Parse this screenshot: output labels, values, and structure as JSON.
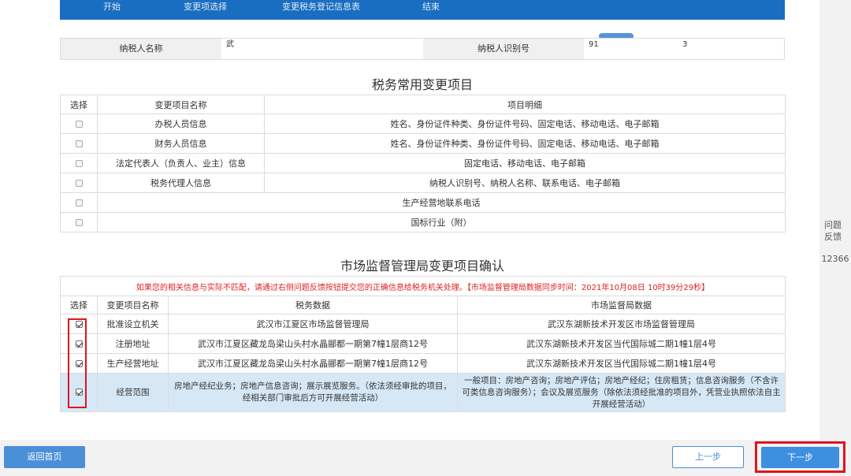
{
  "steps": [
    "开始",
    "变更项选择",
    "变更税务登记信息表",
    "结束"
  ],
  "taxpayer": {
    "name_label": "纳税人名称",
    "name_value": "武",
    "id_label": "纳税人识别号",
    "id_value_start": "91",
    "id_value_end": "3"
  },
  "tax_section": {
    "title": "税务常用变更项目",
    "headers": [
      "选择",
      "变更项目名称",
      "项目明细"
    ],
    "rows": [
      {
        "name": "办税人员信息",
        "detail": "姓名、身份证件种类、身份证件号码、固定电话、移动电话、电子邮箱",
        "checked": false
      },
      {
        "name": "财务人员信息",
        "detail": "姓名、身份证件种类、身份证件号码、固定电话、移动电话、电子邮箱",
        "checked": false
      },
      {
        "name": "法定代表人（负责人、业主）信息",
        "detail": "固定电话、移动电话、电子邮箱",
        "checked": false
      },
      {
        "name": "税务代理人信息",
        "detail": "纳税人识别号、纳税人名称、联系电话、电子邮箱",
        "checked": false
      },
      {
        "name": "生产经营地联系电话",
        "detail": "",
        "checked": false
      },
      {
        "name": "国标行业（附）",
        "detail": "",
        "checked": false
      }
    ]
  },
  "market_section": {
    "title": "市场监督管理局变更项目确认",
    "notice": "如果您的相关信息与实际不匹配，请通过右侧问题反馈按钮提交您的正确信息给税务机关处理。【市场监督管理局数据同步时间：2021年10月08日 10时39分29秒】",
    "headers": [
      "选择",
      "变更项目名称",
      "税务数据",
      "市场监督局数据"
    ],
    "rows": [
      {
        "name": "批准设立机关",
        "tax": "武汉市江夏区市场监督管理局",
        "market": "武汉东湖新技术开发区市场监督管理局",
        "checked": true
      },
      {
        "name": "注册地址",
        "tax": "武汉市江夏区藏龙岛梁山头村水晶郦都一期第7幢1层商12号",
        "market": "武汉东湖新技术开发区当代国际城二期1幢1层4号",
        "checked": true
      },
      {
        "name": "生产经营地址",
        "tax": "武汉市江夏区藏龙岛梁山头村水晶郦都一期第7幢1层商12号",
        "market": "武汉东湖新技术开发区当代国际城二期1幢1层4号",
        "checked": true
      },
      {
        "name": "经营范围",
        "tax": "房地产经纪业务；房地产信息咨询；展示展览服务。（依法须经审批的项目，经相关部门审批后方可开展经营活动）",
        "market": "一般项目：房地产咨询；房地产评估；房地产经纪；住房租赁；信息咨询服务（不含许可类信息咨询服务）；会议及展览服务（除依法须经批准的项目外，凭营业执照依法自主开展经营活动）",
        "checked": true
      }
    ]
  },
  "side": {
    "feedback_line1": "问题",
    "feedback_line2": "反馈",
    "hotline": "12366"
  },
  "buttons": {
    "home": "返回首页",
    "prev": "上一步",
    "next": "下一步"
  },
  "colors": {
    "primary": "#1a6ec1",
    "button": "#4a90d9",
    "highlight_red": "#e0141e",
    "notice_red": "#e02020",
    "selected_row": "#d6e8f6"
  }
}
